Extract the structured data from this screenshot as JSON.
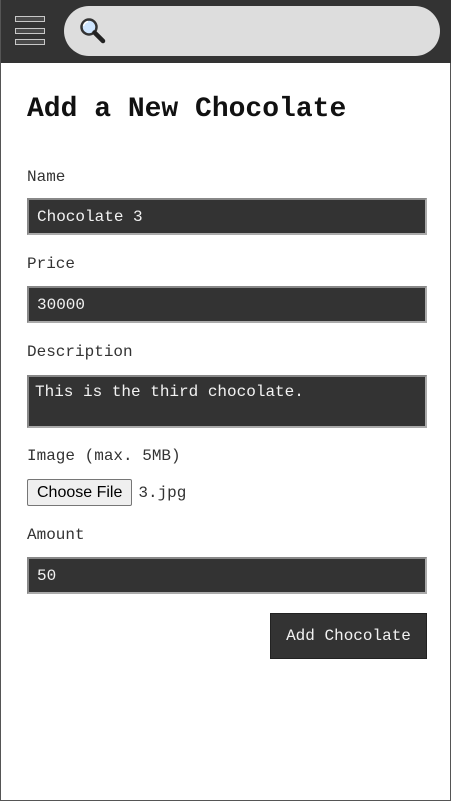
{
  "header": {
    "menu_icon": "hamburger-menu-icon",
    "search_icon": "magnifying-glass-icon",
    "search_value": ""
  },
  "form": {
    "title": "Add a New Chocolate",
    "name_label": "Name",
    "name_value": "Chocolate 3",
    "price_label": "Price",
    "price_value": "30000",
    "description_label": "Description",
    "description_value": "This is the third chocolate.",
    "image_label": "Image (max. 5MB)",
    "choose_file_label": "Choose File",
    "file_name": "3.jpg",
    "amount_label": "Amount",
    "amount_value": "50",
    "submit_label": "Add Chocolate"
  },
  "colors": {
    "header_bg": "#333333",
    "field_bg": "#333333",
    "search_bg": "#dddddd"
  }
}
